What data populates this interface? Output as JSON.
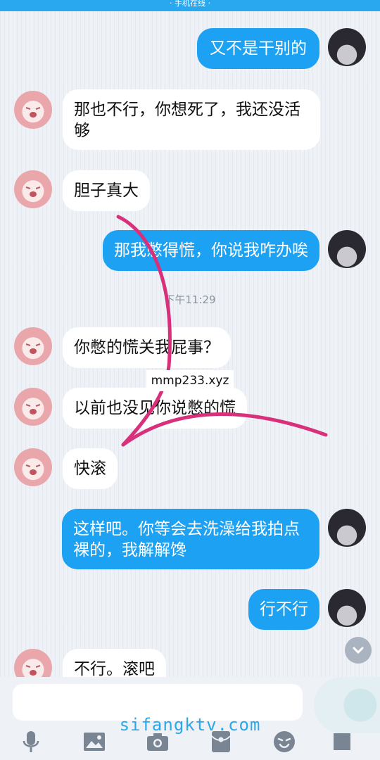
{
  "status_bar": {
    "text": "· 手机在线 ·"
  },
  "messages": [
    {
      "side": "out",
      "text": "又不是干别的"
    },
    {
      "side": "in",
      "text": "那也不行，你想死了，我还没活\n够"
    },
    {
      "side": "in",
      "text": "胆子真大"
    },
    {
      "side": "out",
      "text": "那我憋得慌，你说我咋办唉"
    },
    {
      "side": "in",
      "text": "你憋的慌关我屁事？"
    },
    {
      "side": "in",
      "text": "以前也没见你说憋的慌"
    },
    {
      "side": "in",
      "text": "快滚"
    },
    {
      "side": "out",
      "text": "这样吧。你等会去洗澡给我拍点\n裸的，我解解馋"
    },
    {
      "side": "out",
      "text": "行不行"
    },
    {
      "side": "in",
      "text": "不行。滚吧"
    }
  ],
  "timestamp": "下午11:29",
  "watermarks": {
    "middle": "mmp233.xyz",
    "bottom": "sifangktv.com"
  },
  "input": {
    "placeholder": ""
  },
  "toolbar": [
    "microphone-icon",
    "image-icon",
    "camera-icon",
    "red-packet-icon",
    "emoji-icon",
    "more-icon"
  ],
  "colors": {
    "outgoing_bubble": "#1da1f2",
    "incoming_bubble": "#ffffff",
    "annotation_stroke": "#d8307a"
  }
}
